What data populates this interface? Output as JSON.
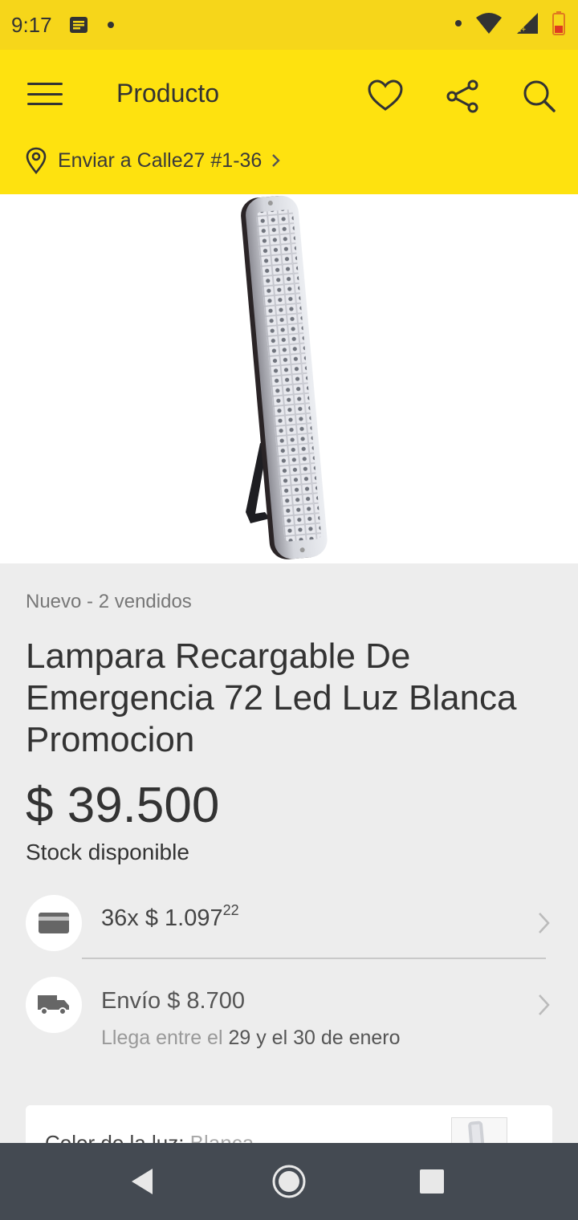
{
  "status_bar": {
    "time": "9:17"
  },
  "header": {
    "title": "Producto"
  },
  "location": {
    "text": "Enviar a Calle27 #1-36"
  },
  "product": {
    "condition": "Nuevo - 2 vendidos",
    "title": "Lampara Recargable De Emergencia 72 Led Luz Blanca Promocion",
    "price": "$ 39.500",
    "stock": "Stock disponible"
  },
  "installments": {
    "count": "36x",
    "amount": "$ 1.097",
    "cents": "22"
  },
  "shipping": {
    "label": "Envío $ 8.700",
    "arrival_prefix": "Llega entre el",
    "arrival_dates": "29 y el 30 de enero"
  },
  "variant": {
    "label": "Color de la luz:",
    "value": "Blanca"
  },
  "colors": {
    "header_yellow": "#fee20f",
    "status_yellow": "#f6d61a",
    "nav_bar": "#444a52"
  }
}
